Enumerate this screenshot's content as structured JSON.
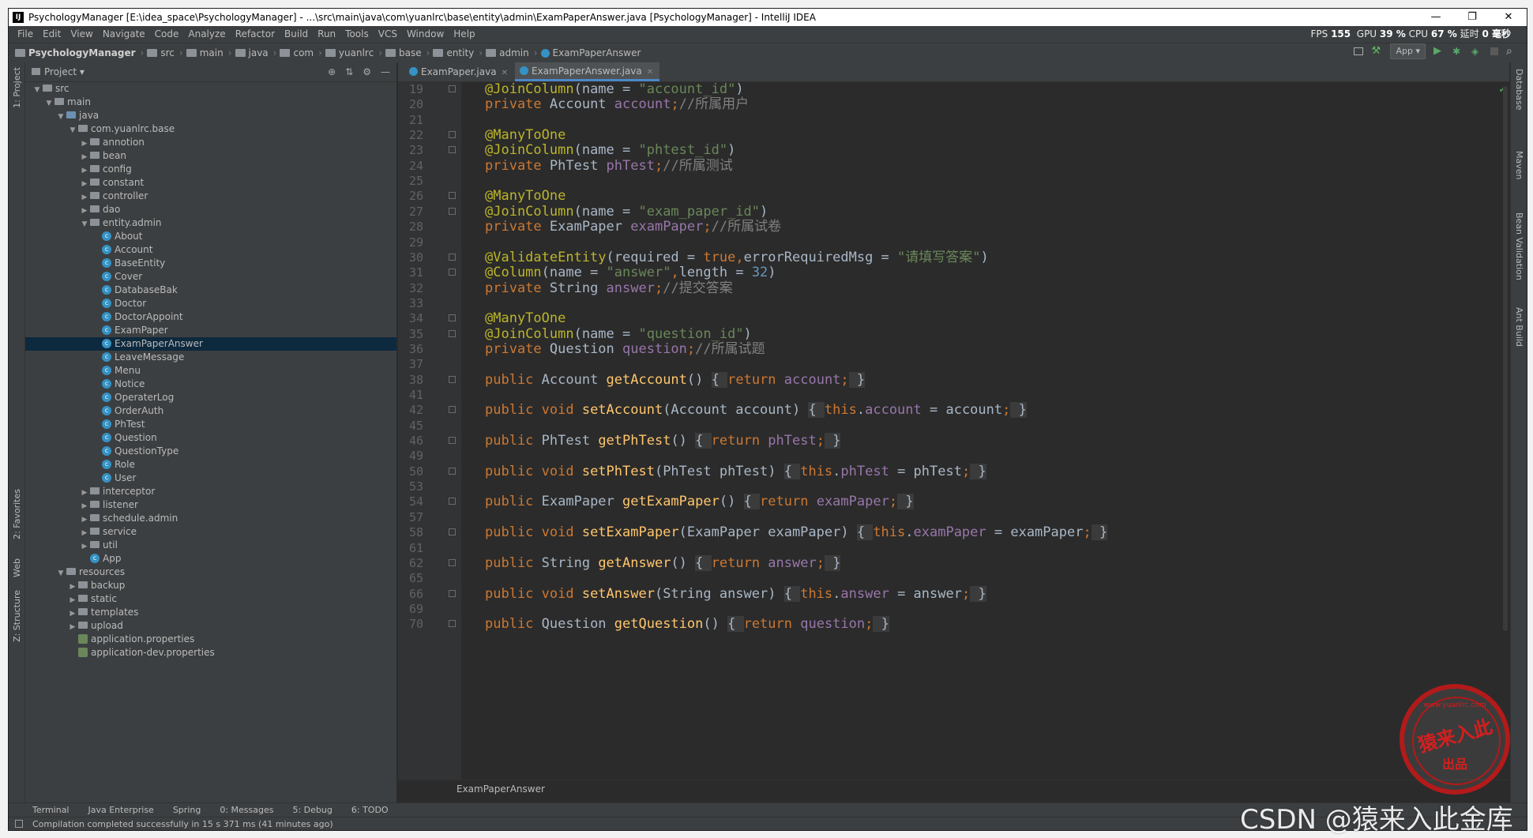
{
  "window": {
    "title": "PsychologyManager [E:\\idea_space\\PsychologyManager] - ...\\src\\main\\java\\com\\yuanlrc\\base\\entity\\admin\\ExamPaperAnswer.java [PsychologyManager] - IntelliJ IDEA",
    "minimize": "—",
    "restore": "❐",
    "close": "✕"
  },
  "menu": [
    "File",
    "Edit",
    "View",
    "Navigate",
    "Code",
    "Analyze",
    "Refactor",
    "Build",
    "Run",
    "Tools",
    "VCS",
    "Window",
    "Help"
  ],
  "perf": {
    "fps_label": "FPS",
    "fps": "155",
    "gpu_label": "GPU",
    "gpu": "39 %",
    "cpu_label": "CPU",
    "cpu": "67 %",
    "delay_label": "延时",
    "delay": "0 毫秒"
  },
  "breadcrumbs": [
    "PsychologyManager",
    "src",
    "main",
    "java",
    "com",
    "yuanlrc",
    "base",
    "entity",
    "admin",
    "ExamPaperAnswer"
  ],
  "run_config": "App",
  "project_panel": {
    "title": "Project"
  },
  "left_stripe": {
    "project": "1: Project",
    "favorites": "2: Favorites",
    "web": "Web",
    "structure": "Z: Structure"
  },
  "right_stripe": {
    "database": "Database",
    "maven": "Maven",
    "bean_validation": "Bean Validation",
    "ant_build": "Ant Build"
  },
  "tree": [
    {
      "label": "src",
      "depth": 1,
      "arrow": "▼",
      "icon": "folder"
    },
    {
      "label": "main",
      "depth": 2,
      "arrow": "▼",
      "icon": "folder"
    },
    {
      "label": "java",
      "depth": 3,
      "arrow": "▼",
      "icon": "folder-blue"
    },
    {
      "label": "com.yuanlrc.base",
      "depth": 4,
      "arrow": "▼",
      "icon": "folder"
    },
    {
      "label": "annotion",
      "depth": 5,
      "arrow": "▶",
      "icon": "folder"
    },
    {
      "label": "bean",
      "depth": 5,
      "arrow": "▶",
      "icon": "folder"
    },
    {
      "label": "config",
      "depth": 5,
      "arrow": "▶",
      "icon": "folder"
    },
    {
      "label": "constant",
      "depth": 5,
      "arrow": "▶",
      "icon": "folder"
    },
    {
      "label": "controller",
      "depth": 5,
      "arrow": "▶",
      "icon": "folder"
    },
    {
      "label": "dao",
      "depth": 5,
      "arrow": "▶",
      "icon": "folder"
    },
    {
      "label": "entity.admin",
      "depth": 5,
      "arrow": "▼",
      "icon": "folder"
    },
    {
      "label": "About",
      "depth": 6,
      "arrow": "",
      "icon": "class"
    },
    {
      "label": "Account",
      "depth": 6,
      "arrow": "",
      "icon": "class"
    },
    {
      "label": "BaseEntity",
      "depth": 6,
      "arrow": "",
      "icon": "class"
    },
    {
      "label": "Cover",
      "depth": 6,
      "arrow": "",
      "icon": "class"
    },
    {
      "label": "DatabaseBak",
      "depth": 6,
      "arrow": "",
      "icon": "class"
    },
    {
      "label": "Doctor",
      "depth": 6,
      "arrow": "",
      "icon": "class"
    },
    {
      "label": "DoctorAppoint",
      "depth": 6,
      "arrow": "",
      "icon": "class"
    },
    {
      "label": "ExamPaper",
      "depth": 6,
      "arrow": "",
      "icon": "class"
    },
    {
      "label": "ExamPaperAnswer",
      "depth": 6,
      "arrow": "",
      "icon": "class",
      "selected": true
    },
    {
      "label": "LeaveMessage",
      "depth": 6,
      "arrow": "",
      "icon": "class"
    },
    {
      "label": "Menu",
      "depth": 6,
      "arrow": "",
      "icon": "class"
    },
    {
      "label": "Notice",
      "depth": 6,
      "arrow": "",
      "icon": "class"
    },
    {
      "label": "OperaterLog",
      "depth": 6,
      "arrow": "",
      "icon": "class"
    },
    {
      "label": "OrderAuth",
      "depth": 6,
      "arrow": "",
      "icon": "class"
    },
    {
      "label": "PhTest",
      "depth": 6,
      "arrow": "",
      "icon": "class"
    },
    {
      "label": "Question",
      "depth": 6,
      "arrow": "",
      "icon": "class"
    },
    {
      "label": "QuestionType",
      "depth": 6,
      "arrow": "",
      "icon": "class"
    },
    {
      "label": "Role",
      "depth": 6,
      "arrow": "",
      "icon": "class"
    },
    {
      "label": "User",
      "depth": 6,
      "arrow": "",
      "icon": "class"
    },
    {
      "label": "interceptor",
      "depth": 5,
      "arrow": "▶",
      "icon": "folder"
    },
    {
      "label": "listener",
      "depth": 5,
      "arrow": "▶",
      "icon": "folder"
    },
    {
      "label": "schedule.admin",
      "depth": 5,
      "arrow": "▶",
      "icon": "folder"
    },
    {
      "label": "service",
      "depth": 5,
      "arrow": "▶",
      "icon": "folder"
    },
    {
      "label": "util",
      "depth": 5,
      "arrow": "▶",
      "icon": "folder"
    },
    {
      "label": "App",
      "depth": 5,
      "arrow": "",
      "icon": "class"
    },
    {
      "label": "resources",
      "depth": 3,
      "arrow": "▼",
      "icon": "folder"
    },
    {
      "label": "backup",
      "depth": 4,
      "arrow": "▶",
      "icon": "folder"
    },
    {
      "label": "static",
      "depth": 4,
      "arrow": "▶",
      "icon": "folder"
    },
    {
      "label": "templates",
      "depth": 4,
      "arrow": "▶",
      "icon": "folder"
    },
    {
      "label": "upload",
      "depth": 4,
      "arrow": "▶",
      "icon": "folder"
    },
    {
      "label": "application.properties",
      "depth": 4,
      "arrow": "",
      "icon": "props"
    },
    {
      "label": "application-dev.properties",
      "depth": 4,
      "arrow": "",
      "icon": "props"
    }
  ],
  "tabs": [
    {
      "label": "ExamPaper.java",
      "active": false
    },
    {
      "label": "ExamPaperAnswer.java",
      "active": true
    }
  ],
  "code_lines": [
    {
      "n": "19",
      "fold": true,
      "seg": [
        [
          "ann",
          "@JoinColumn"
        ],
        [
          "p",
          "(name = "
        ],
        [
          "str",
          "\"account_id\""
        ],
        [
          "p",
          ")"
        ]
      ]
    },
    {
      "n": "20",
      "fold": false,
      "seg": [
        [
          "kw",
          "private "
        ],
        [
          "p",
          "Account "
        ],
        [
          "fld",
          "account"
        ],
        [
          "kw",
          ";"
        ],
        [
          "cmt",
          "//所属用户"
        ]
      ]
    },
    {
      "n": "21",
      "fold": false,
      "seg": []
    },
    {
      "n": "22",
      "fold": true,
      "seg": [
        [
          "ann",
          "@ManyToOne"
        ]
      ]
    },
    {
      "n": "23",
      "fold": true,
      "seg": [
        [
          "ann",
          "@JoinColumn"
        ],
        [
          "p",
          "(name = "
        ],
        [
          "str",
          "\"phtest_id\""
        ],
        [
          "p",
          ")"
        ]
      ]
    },
    {
      "n": "24",
      "fold": false,
      "seg": [
        [
          "kw",
          "private "
        ],
        [
          "p",
          "PhTest "
        ],
        [
          "fld",
          "phTest"
        ],
        [
          "kw",
          ";"
        ],
        [
          "cmt",
          "//所属测试"
        ]
      ]
    },
    {
      "n": "25",
      "fold": false,
      "seg": []
    },
    {
      "n": "26",
      "fold": true,
      "seg": [
        [
          "ann",
          "@ManyToOne"
        ]
      ]
    },
    {
      "n": "27",
      "fold": true,
      "seg": [
        [
          "ann",
          "@JoinColumn"
        ],
        [
          "p",
          "(name = "
        ],
        [
          "str",
          "\"exam_paper_id\""
        ],
        [
          "p",
          ")"
        ]
      ]
    },
    {
      "n": "28",
      "fold": false,
      "seg": [
        [
          "kw",
          "private "
        ],
        [
          "p",
          "ExamPaper "
        ],
        [
          "fld",
          "examPaper"
        ],
        [
          "kw",
          ";"
        ],
        [
          "cmt",
          "//所属试卷"
        ]
      ]
    },
    {
      "n": "29",
      "fold": false,
      "seg": []
    },
    {
      "n": "30",
      "fold": true,
      "seg": [
        [
          "ann",
          "@ValidateEntity"
        ],
        [
          "p",
          "(required = "
        ],
        [
          "kw",
          "true"
        ],
        [
          "kw",
          ","
        ],
        [
          "p",
          "errorRequiredMsg = "
        ],
        [
          "str",
          "\"请填写答案\""
        ],
        [
          "p",
          ")"
        ]
      ]
    },
    {
      "n": "31",
      "fold": true,
      "seg": [
        [
          "ann",
          "@Column"
        ],
        [
          "p",
          "(name = "
        ],
        [
          "str",
          "\"answer\""
        ],
        [
          "kw",
          ","
        ],
        [
          "p",
          "length = "
        ],
        [
          "num",
          "32"
        ],
        [
          "p",
          ")"
        ]
      ]
    },
    {
      "n": "32",
      "fold": false,
      "seg": [
        [
          "kw",
          "private "
        ],
        [
          "p",
          "String "
        ],
        [
          "fld",
          "answer"
        ],
        [
          "kw",
          ";"
        ],
        [
          "cmt",
          "//提交答案"
        ]
      ]
    },
    {
      "n": "33",
      "fold": false,
      "seg": []
    },
    {
      "n": "34",
      "fold": true,
      "seg": [
        [
          "ann",
          "@ManyToOne"
        ]
      ]
    },
    {
      "n": "35",
      "fold": true,
      "seg": [
        [
          "ann",
          "@JoinColumn"
        ],
        [
          "p",
          "(name = "
        ],
        [
          "str",
          "\"question_id\""
        ],
        [
          "p",
          ")"
        ]
      ]
    },
    {
      "n": "36",
      "fold": false,
      "seg": [
        [
          "kw",
          "private "
        ],
        [
          "p",
          "Question "
        ],
        [
          "fld",
          "question"
        ],
        [
          "kw",
          ";"
        ],
        [
          "cmt",
          "//所属试题"
        ]
      ]
    },
    {
      "n": "37",
      "fold": false,
      "seg": []
    },
    {
      "n": "38",
      "fold": true,
      "seg": [
        [
          "kw",
          "public "
        ],
        [
          "p",
          "Account "
        ],
        [
          "mth",
          "getAccount"
        ],
        [
          "p",
          "() "
        ],
        [
          "brc",
          "{ "
        ],
        [
          "kw",
          "return "
        ],
        [
          "fld",
          "account"
        ],
        [
          "kw",
          ";"
        ],
        [
          "brc",
          " }"
        ]
      ]
    },
    {
      "n": "41",
      "fold": false,
      "seg": []
    },
    {
      "n": "42",
      "fold": true,
      "seg": [
        [
          "kw",
          "public void "
        ],
        [
          "mth",
          "setAccount"
        ],
        [
          "p",
          "(Account account) "
        ],
        [
          "brc",
          "{ "
        ],
        [
          "kw",
          "this"
        ],
        [
          "p",
          "."
        ],
        [
          "fld",
          "account"
        ],
        [
          "p",
          " = account"
        ],
        [
          "kw",
          ";"
        ],
        [
          "brc",
          " }"
        ]
      ]
    },
    {
      "n": "45",
      "fold": false,
      "seg": []
    },
    {
      "n": "46",
      "fold": true,
      "seg": [
        [
          "kw",
          "public "
        ],
        [
          "p",
          "PhTest "
        ],
        [
          "mth",
          "getPhTest"
        ],
        [
          "p",
          "() "
        ],
        [
          "brc",
          "{ "
        ],
        [
          "kw",
          "return "
        ],
        [
          "fld",
          "phTest"
        ],
        [
          "kw",
          ";"
        ],
        [
          "brc",
          " }"
        ]
      ]
    },
    {
      "n": "49",
      "fold": false,
      "seg": []
    },
    {
      "n": "50",
      "fold": true,
      "seg": [
        [
          "kw",
          "public void "
        ],
        [
          "mth",
          "setPhTest"
        ],
        [
          "p",
          "(PhTest phTest) "
        ],
        [
          "brc",
          "{ "
        ],
        [
          "kw",
          "this"
        ],
        [
          "p",
          "."
        ],
        [
          "fld",
          "phTest"
        ],
        [
          "p",
          " = phTest"
        ],
        [
          "kw",
          ";"
        ],
        [
          "brc",
          " }"
        ]
      ]
    },
    {
      "n": "53",
      "fold": false,
      "seg": []
    },
    {
      "n": "54",
      "fold": true,
      "seg": [
        [
          "kw",
          "public "
        ],
        [
          "p",
          "ExamPaper "
        ],
        [
          "mth",
          "getExamPaper"
        ],
        [
          "p",
          "() "
        ],
        [
          "brc",
          "{ "
        ],
        [
          "kw",
          "return "
        ],
        [
          "fld",
          "examPaper"
        ],
        [
          "kw",
          ";"
        ],
        [
          "brc",
          " }"
        ]
      ]
    },
    {
      "n": "57",
      "fold": false,
      "seg": []
    },
    {
      "n": "58",
      "fold": true,
      "seg": [
        [
          "kw",
          "public void "
        ],
        [
          "mth",
          "setExamPaper"
        ],
        [
          "p",
          "(ExamPaper examPaper) "
        ],
        [
          "brc",
          "{ "
        ],
        [
          "kw",
          "this"
        ],
        [
          "p",
          "."
        ],
        [
          "fld",
          "examPaper"
        ],
        [
          "p",
          " = examPaper"
        ],
        [
          "kw",
          ";"
        ],
        [
          "brc",
          " }"
        ]
      ]
    },
    {
      "n": "61",
      "fold": false,
      "seg": []
    },
    {
      "n": "62",
      "fold": true,
      "seg": [
        [
          "kw",
          "public "
        ],
        [
          "p",
          "String "
        ],
        [
          "mth",
          "getAnswer"
        ],
        [
          "p",
          "() "
        ],
        [
          "brc",
          "{ "
        ],
        [
          "kw",
          "return "
        ],
        [
          "fld",
          "answer"
        ],
        [
          "kw",
          ";"
        ],
        [
          "brc",
          " }"
        ]
      ]
    },
    {
      "n": "65",
      "fold": false,
      "seg": []
    },
    {
      "n": "66",
      "fold": true,
      "seg": [
        [
          "kw",
          "public void "
        ],
        [
          "mth",
          "setAnswer"
        ],
        [
          "p",
          "(String answer) "
        ],
        [
          "brc",
          "{ "
        ],
        [
          "kw",
          "this"
        ],
        [
          "p",
          "."
        ],
        [
          "fld",
          "answer"
        ],
        [
          "p",
          " = answer"
        ],
        [
          "kw",
          ";"
        ],
        [
          "brc",
          " }"
        ]
      ]
    },
    {
      "n": "69",
      "fold": false,
      "seg": []
    },
    {
      "n": "70",
      "fold": true,
      "seg": [
        [
          "kw",
          "public "
        ],
        [
          "p",
          "Question "
        ],
        [
          "mth",
          "getQuestion"
        ],
        [
          "p",
          "() "
        ],
        [
          "brc",
          "{ "
        ],
        [
          "kw",
          "return "
        ],
        [
          "fld",
          "question"
        ],
        [
          "kw",
          ";"
        ],
        [
          "brc",
          " }"
        ]
      ]
    }
  ],
  "editor_breadcrumb": "ExamPaperAnswer",
  "toolwindows": [
    "Terminal",
    "Java Enterprise",
    "Spring",
    "0: Messages",
    "5: Debug",
    "6: TODO"
  ],
  "status": "Compilation completed successfully in 15 s 371 ms (41 minutes ago)",
  "watermark": {
    "stamp_url": "www.yuanlrc.com",
    "stamp_main": "猿来入此",
    "stamp_sub": "出品",
    "csdn": "CSDN @猿来入此金库"
  },
  "colors": {
    "keyword": "#cc7832",
    "annotation": "#bbb529",
    "string": "#6a8759",
    "field": "#9876aa",
    "comment": "#808080",
    "number": "#6897bb",
    "method": "#ffc66d",
    "plain": "#a9b7c6",
    "selection": "#0d293e"
  }
}
